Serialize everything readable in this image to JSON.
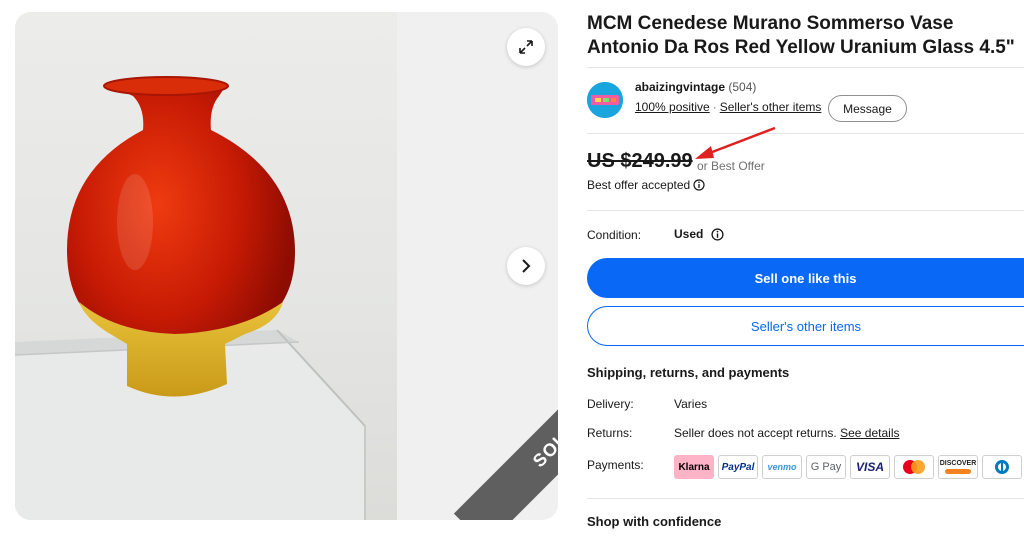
{
  "gallery": {
    "sold_label": "SOLD",
    "expand_icon": "expand-icon",
    "next_icon": "chevron-right-icon"
  },
  "item": {
    "title": "MCM Cenedese Murano Sommerso Vase Antonio Da Ros Red Yellow Uranium Glass 4.5\""
  },
  "seller": {
    "name": "abaizingvintage",
    "feedback_count": "(504)",
    "positive": "100% positive",
    "separator": "·",
    "other_items": "Seller's other items",
    "message_button": "Message"
  },
  "price": {
    "amount": "US $249.99",
    "best_offer": "or Best Offer",
    "offer_accepted": "Best offer accepted"
  },
  "condition": {
    "label": "Condition:",
    "value": "Used"
  },
  "actions": {
    "sell_button": "Sell one like this",
    "seller_items_button": "Seller's other items"
  },
  "shipping": {
    "heading": "Shipping, returns, and payments",
    "delivery_label": "Delivery:",
    "delivery_value": "Varies",
    "returns_label": "Returns:",
    "returns_value": "Seller does not accept returns.",
    "returns_link": "See details",
    "payments_label": "Payments:",
    "payment_methods": [
      "Klarna",
      "PayPal",
      "venmo",
      "G Pay",
      "VISA",
      "Mastercard",
      "DISCOVER",
      "Diners Club"
    ]
  },
  "confidence": {
    "heading": "Shop with confidence"
  },
  "colors": {
    "primary_blue": "#0968f6",
    "sold_band": "#5f5f5f",
    "annotation_arrow": "#e02020"
  }
}
